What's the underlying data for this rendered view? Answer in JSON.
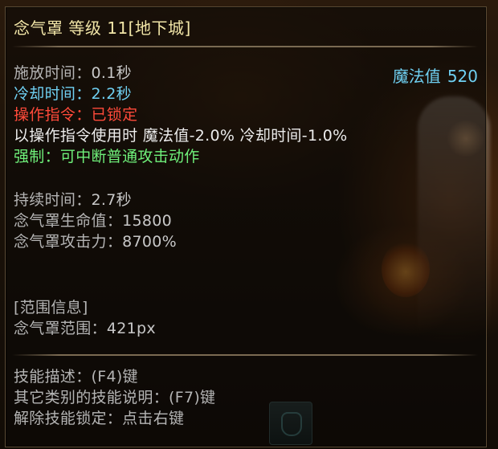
{
  "title": "念气罩 等级 11[地下城]",
  "mana": {
    "label": "魔法值",
    "value": "520"
  },
  "cast": {
    "label": "施放时间",
    "sep": "：",
    "value": "0.1秒"
  },
  "cooldown": {
    "label": "冷却时间",
    "sep": "：",
    "value": "2.2秒"
  },
  "command": {
    "label": "操作指令",
    "sep": "：",
    "value": "已锁定"
  },
  "command_bonus": "以操作指令使用时 魔法值-2.0% 冷却时间-1.0%",
  "force": "强制：可中断普通攻击动作",
  "duration": {
    "label": "持续时间",
    "sep": "：",
    "value": "2.7秒"
  },
  "shield_hp": {
    "label": "念气罩生命值",
    "sep": "：",
    "value": "15800"
  },
  "shield_atk": {
    "label": "念气罩攻击力",
    "sep": "：",
    "value": "8700%"
  },
  "range_header": "[范围信息]",
  "shield_range": {
    "label": "念气罩范围",
    "sep": "：",
    "value": "421px"
  },
  "help": {
    "describe": "技能描述：(F4)键",
    "other": "其它类别的技能说明：(F7)键",
    "unlock": "解除技能锁定：点击右键"
  },
  "colors": {
    "title": "#f2e6a8",
    "gray": "#b4b4b4",
    "blue": "#6fd0f2",
    "red": "#ff4a3a",
    "green": "#6ff07a",
    "white": "#ececec"
  }
}
